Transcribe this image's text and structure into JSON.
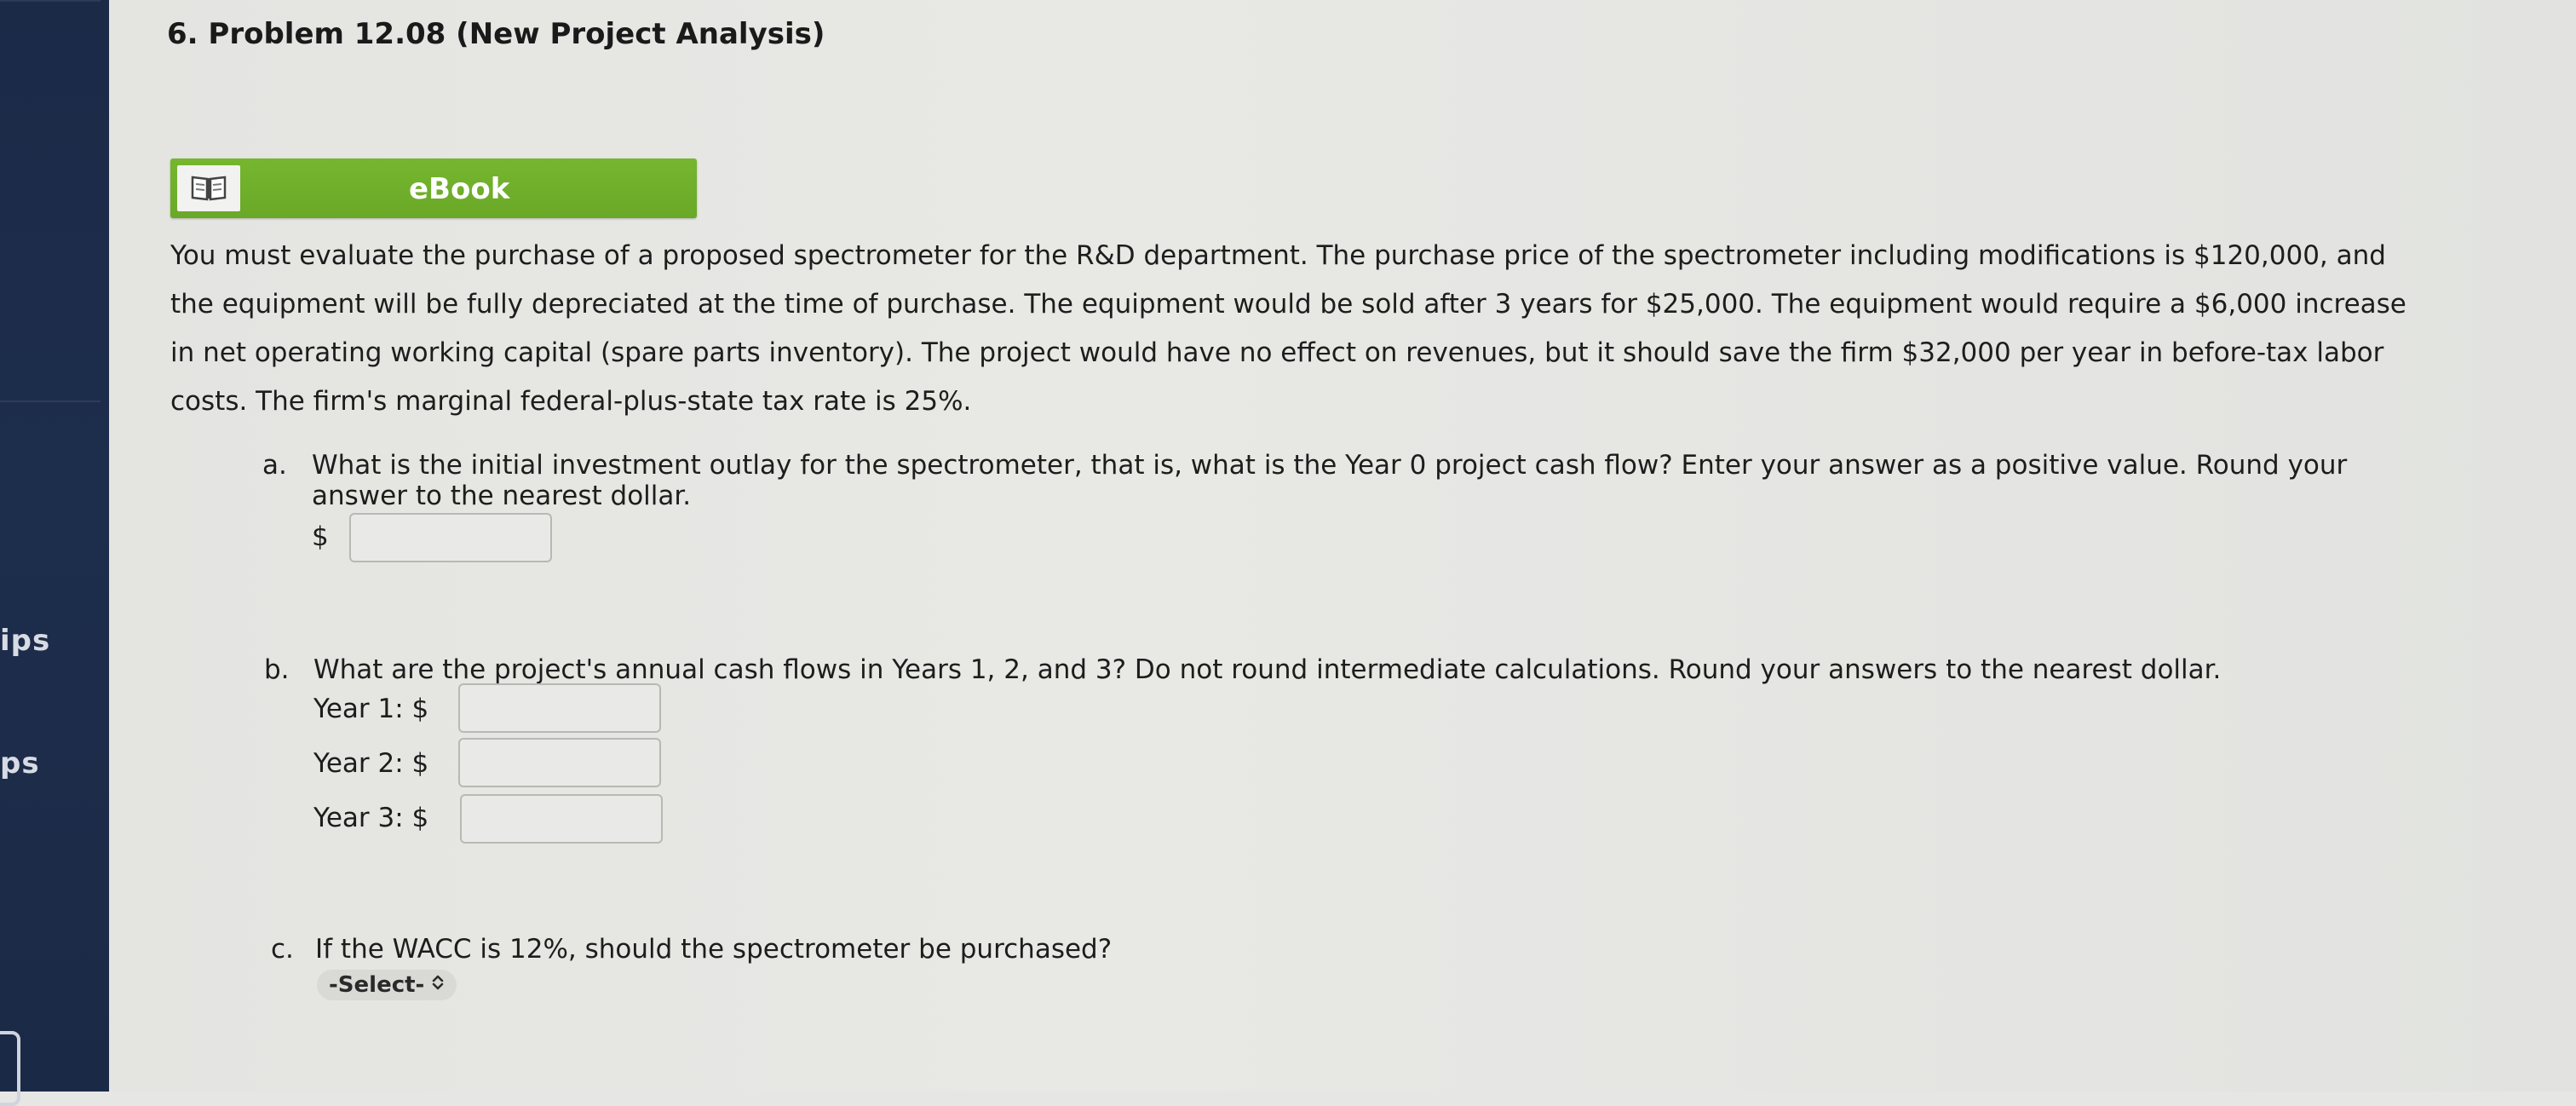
{
  "sidebar": {
    "items": [
      {
        "label": "ips"
      },
      {
        "label": "ps"
      }
    ]
  },
  "problem": {
    "title": "6. Problem 12.08 (New Project Analysis)",
    "ebook_label": "eBook",
    "ebook_icon": "book-icon",
    "paragraph_lines": [
      "You must evaluate the purchase of a proposed spectrometer for the R&D department. The purchase price of the spectrometer including modifications is $120,000, and",
      "the equipment will be fully depreciated at the time of purchase. The equipment would be sold after 3 years for $25,000. The equipment would require a $6,000 increase",
      "in net operating working capital (spare parts inventory). The project would have no effect on revenues, but it should save the firm $32,000 per year in before-tax labor",
      "costs. The firm's marginal federal-plus-state tax rate is 25%."
    ]
  },
  "questions": {
    "a": {
      "letter": "a.",
      "text_line1": "What is the initial investment outlay for the spectrometer, that is, what is the Year 0 project cash flow? Enter your answer as a positive value. Round your",
      "text_line2": "answer to the nearest dollar.",
      "currency": "$",
      "value": ""
    },
    "b": {
      "letter": "b.",
      "text": "What are the project's annual cash flows in Years 1, 2, and 3? Do not round intermediate calculations. Round your answers to the nearest dollar.",
      "rows": [
        {
          "label": "Year 1: $",
          "value": ""
        },
        {
          "label": "Year 2: $",
          "value": ""
        },
        {
          "label": "Year 3: $",
          "value": ""
        }
      ]
    },
    "c": {
      "letter": "c.",
      "text": "If the WACC is 12%, should the spectrometer be purchased?",
      "select_label": "-Select-",
      "select_icon": "updown-chevron-icon"
    }
  },
  "colors": {
    "sidebar": "#1c2b49",
    "ebook_green": "#72b22c",
    "page_bg": "#e6e6e4"
  }
}
